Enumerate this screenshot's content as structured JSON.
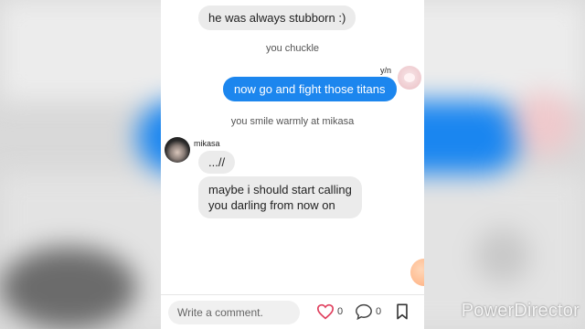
{
  "messages": {
    "m1": "he was always stubborn :)",
    "narr1": "you chuckle",
    "yn_sender": "y/n",
    "m2": "now go and fight those titans",
    "narr2": "you smile warmly at mikasa",
    "mk_sender": "mikasa",
    "m3": "...//",
    "m4_line1": "maybe i should start calling",
    "m4_line2": "you darling from now on"
  },
  "footer": {
    "comment_placeholder": "Write a comment.",
    "like_count": "0",
    "comment_count": "0"
  },
  "colors": {
    "outgoing_bubble": "#1c86ee",
    "incoming_bubble": "#ebebeb",
    "like_icon": "#e0405e"
  },
  "icons": [
    "heart-icon",
    "comment-icon",
    "bookmark-icon"
  ],
  "watermark": "PowerDirector"
}
